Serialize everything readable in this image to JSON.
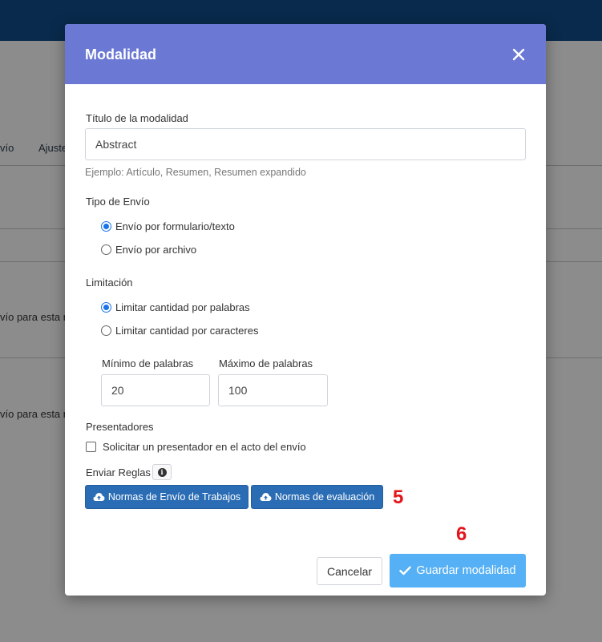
{
  "background": {
    "tab_partial_1": "vío",
    "tab_partial_2": "Ajuste",
    "row_text_1": "vío para esta m",
    "row_text_2": "vío para esta m"
  },
  "modal": {
    "title": "Modalidad",
    "close_icon": "close-icon",
    "title_field": {
      "label": "Título de la modalidad",
      "value": "Abstract",
      "help": "Ejemplo: Artículo, Resumen, Resumen expandido"
    },
    "submission_type": {
      "label": "Tipo de Envío",
      "options": [
        {
          "label": "Envío por formulario/texto",
          "checked": true
        },
        {
          "label": "Envío por archivo",
          "checked": false
        }
      ]
    },
    "limitation": {
      "label": "Limitación",
      "options": [
        {
          "label": "Limitar cantidad por palabras",
          "checked": true
        },
        {
          "label": "Limitar cantidad por caracteres",
          "checked": false
        }
      ],
      "min_label": "Mínimo de palabras",
      "min_value": "20",
      "max_label": "Máximo de palabras",
      "max_value": "100"
    },
    "presenters": {
      "label": "Presentadores",
      "checkbox_label": "Solicitar un presentador en el acto del envío",
      "checked": false
    },
    "rules": {
      "label": "Enviar Reglas",
      "info_icon": "info-icon",
      "button_1": "Normas de Envío de Trabajos",
      "button_2": "Normas de evaluación",
      "upload_icon": "cloud-upload-icon"
    },
    "annotations": [
      "5",
      "6"
    ],
    "footer": {
      "cancel": "Cancelar",
      "save": "Guardar modalidad",
      "save_icon": "check-icon"
    },
    "colors": {
      "header": "#6b78d4",
      "primary_button": "#2a6db5",
      "save_button": "#55b0f5",
      "annotation": "#e3151b"
    }
  }
}
